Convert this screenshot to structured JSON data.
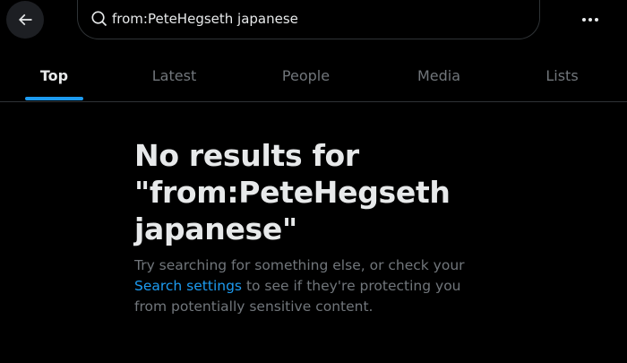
{
  "header": {
    "back_icon": "arrow-left-icon",
    "search_icon": "search-icon",
    "search_value": "from:PeteHegseth japanese",
    "more_icon": "more-horizontal-icon"
  },
  "tabs": [
    {
      "label": "Top",
      "active": true
    },
    {
      "label": "Latest",
      "active": false
    },
    {
      "label": "People",
      "active": false
    },
    {
      "label": "Media",
      "active": false
    },
    {
      "label": "Lists",
      "active": false
    }
  ],
  "empty_state": {
    "title_line1": "No results for",
    "title_line2": "\"from:PeteHegseth",
    "title_line3": "japanese\"",
    "desc_before": "Try searching for something else, or check your",
    "desc_link": "Search settings",
    "desc_after": "to see if they're protecting you from potentially sensitive content."
  },
  "colors": {
    "background": "#000000",
    "accent": "#1d9bf0",
    "text_primary": "#e7e9ea",
    "text_secondary": "#71767b",
    "border": "#2f3336"
  }
}
